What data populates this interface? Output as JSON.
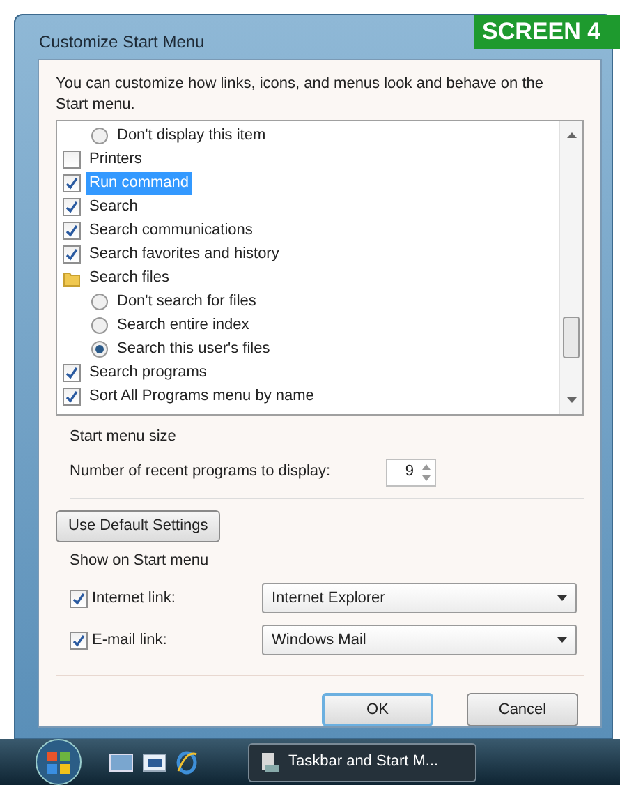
{
  "figure_label": "SCREEN 4",
  "window": {
    "title": "Customize Start Menu"
  },
  "intro": "You can customize how links, icons, and menus look and behave on the Start menu.",
  "options": [
    {
      "kind": "radio",
      "label": "Don't display this item",
      "checked": false,
      "selected": false
    },
    {
      "kind": "checkbox",
      "label": "Printers",
      "checked": false,
      "selected": false
    },
    {
      "kind": "checkbox",
      "label": "Run command",
      "checked": true,
      "selected": true
    },
    {
      "kind": "checkbox",
      "label": "Search",
      "checked": true,
      "selected": false
    },
    {
      "kind": "checkbox",
      "label": "Search communications",
      "checked": true,
      "selected": false
    },
    {
      "kind": "checkbox",
      "label": "Search favorites and history",
      "checked": true,
      "selected": false
    },
    {
      "kind": "folder",
      "label": "Search files",
      "selected": false
    },
    {
      "kind": "radio",
      "label": "Don't search for files",
      "checked": false,
      "selected": false
    },
    {
      "kind": "radio",
      "label": "Search entire index",
      "checked": false,
      "selected": false
    },
    {
      "kind": "radio",
      "label": "Search this user's files",
      "checked": true,
      "selected": false
    },
    {
      "kind": "checkbox",
      "label": "Search programs",
      "checked": true,
      "selected": false
    },
    {
      "kind": "checkbox",
      "label": "Sort All Programs menu by name",
      "checked": true,
      "selected": false
    }
  ],
  "start_menu_size": {
    "heading": "Start menu size",
    "label": "Number of recent programs to display:",
    "value": "9"
  },
  "default_button": "Use Default Settings",
  "show_on_start": {
    "heading": "Show on Start menu",
    "links": [
      {
        "label": "Internet link:",
        "checked": true,
        "value": "Internet Explorer"
      },
      {
        "label": "E-mail link:",
        "checked": true,
        "value": "Windows Mail"
      }
    ]
  },
  "buttons": [
    "OK",
    "Cancel"
  ],
  "taskbar": {
    "task": "Taskbar and Start M..."
  }
}
